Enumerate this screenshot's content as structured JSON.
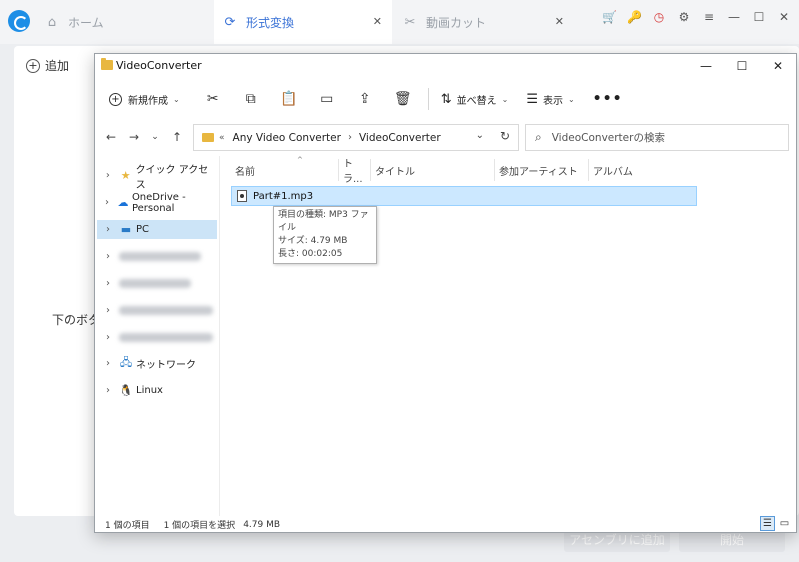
{
  "app": {
    "tabs": [
      {
        "label": "ホーム",
        "icon": "home-icon"
      },
      {
        "label": "形式変換",
        "icon": "convert-icon"
      },
      {
        "label": "動画カット",
        "icon": "scissors-icon"
      }
    ],
    "add_label": "追加",
    "hint_partial": "下のボタ",
    "merge_button": "アセンブリに追加",
    "start_button": "開始",
    "accent_color": "#3a72d6"
  },
  "explorer": {
    "title": "VideoConverter",
    "toolbar": {
      "new_label": "新規作成",
      "sort_label": "並べ替え",
      "view_label": "表示",
      "more_label": "•••"
    },
    "address": {
      "ellipsis": "«",
      "crumbs": [
        "Any Video Converter",
        "VideoConverter"
      ]
    },
    "search_placeholder": "VideoConverterの検索",
    "nav": [
      {
        "label": "クイック アクセス",
        "icon": "star-icon"
      },
      {
        "label": "OneDrive - Personal",
        "icon": "cloud-icon"
      },
      {
        "label": "PC",
        "icon": "pc-icon",
        "selected": true
      },
      {
        "label": "",
        "blurred": true
      },
      {
        "label": "",
        "blurred": true
      },
      {
        "label": "",
        "blurred": true
      },
      {
        "label": "",
        "blurred": true
      },
      {
        "label": "ネットワーク",
        "icon": "network-icon"
      },
      {
        "label": "Linux",
        "icon": "linux-icon"
      }
    ],
    "columns": [
      "名前",
      "トラ...",
      "タイトル",
      "参加アーティスト",
      "アルバム"
    ],
    "files": [
      {
        "name": "Part#1.mp3"
      }
    ],
    "tooltip": {
      "type": "項目の種類: MP3 ファイル",
      "size": "サイズ: 4.79 MB",
      "length": "長さ: 00:02:05"
    },
    "status": {
      "count": "1 個の項目",
      "selected": "1 個の項目を選択",
      "size": "4.79 MB"
    }
  }
}
